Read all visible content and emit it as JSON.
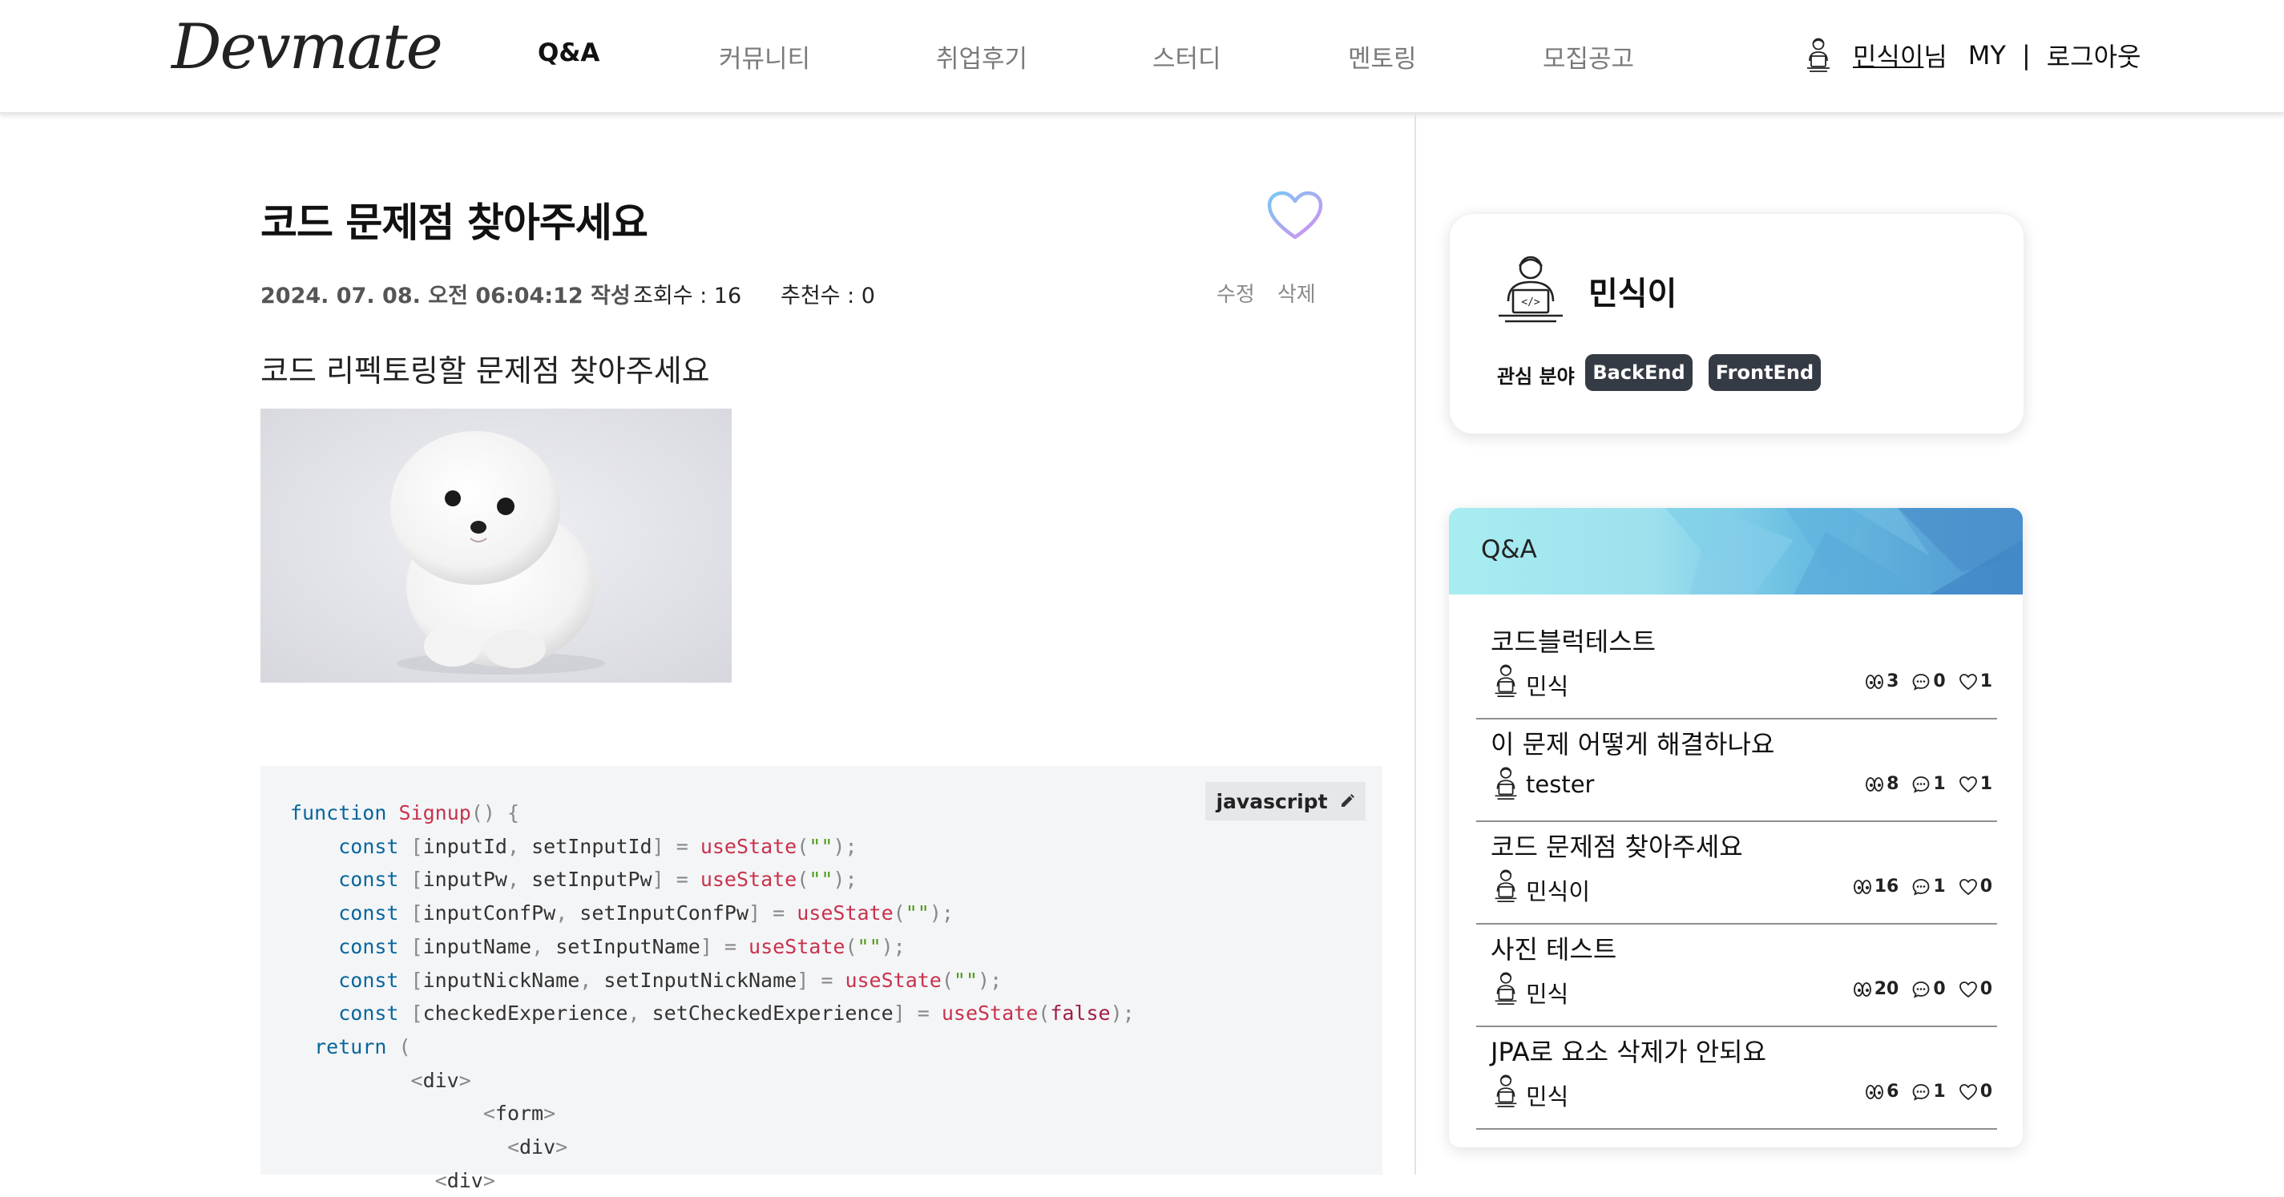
{
  "header": {
    "logo": "Devmate",
    "nav": [
      "Q&A",
      "커뮤니티",
      "취업후기",
      "스터디",
      "멘토링",
      "모집공고"
    ],
    "active_nav": "Q&A",
    "user": {
      "name": "민식이",
      "suffix": "님",
      "my": "MY",
      "separator": "|",
      "logout": "로그아웃"
    }
  },
  "post": {
    "title": "코드 문제점 찾아주세요",
    "date": "2024. 07. 08. 오전 06:04:12 작성",
    "views": "조회수 : 16",
    "recommends": "추천수 : 0",
    "edit_label": "수정",
    "delete_label": "삭제",
    "body": "코드 리펙토링할 문제점 찾아주세요",
    "image_icon": "white-pomeranian-puppy-photo",
    "code_language": "javascript",
    "code_lines": [
      "function Signup() {",
      "    const [inputId, setInputId] = useState(\"\");",
      "    const [inputPw, setInputPw] = useState(\"\");",
      "    const [inputConfPw, setInputConfPw] = useState(\"\");",
      "    const [inputName, setInputName] = useState(\"\");",
      "    const [inputNickName, setInputNickName] = useState(\"\");",
      "    const [checkedExperience, setCheckedExperience] = useState(false);",
      "  return (",
      "          <div>",
      "                <form>",
      "                  <div>",
      "            <div>"
    ]
  },
  "profile": {
    "name": "민식이",
    "interest_label": "관심 분야",
    "interests": [
      "BackEnd",
      "FrontEnd"
    ]
  },
  "qa_panel": {
    "title": "Q&A",
    "items": [
      {
        "title": "코드블럭테스트",
        "author": "민식",
        "views": "3",
        "comments": "0",
        "likes": "1"
      },
      {
        "title": "이 문제 어떻게 해결하나요",
        "author": "tester",
        "views": "8",
        "comments": "1",
        "likes": "1"
      },
      {
        "title": "코드 문제점 찾아주세요",
        "author": "민식이",
        "views": "16",
        "comments": "1",
        "likes": "0"
      },
      {
        "title": "사진 테스트",
        "author": "민식",
        "views": "20",
        "comments": "0",
        "likes": "0"
      },
      {
        "title": "JPA로 요소 삭제가 안되요",
        "author": "민식",
        "views": "6",
        "comments": "1",
        "likes": "0"
      }
    ]
  },
  "colors": {
    "chip_bg": "#353b45",
    "header_gradient_start": "#a6ecef",
    "header_gradient_end": "#4f97cf",
    "heart_gradient_start": "#78c8f5",
    "heart_gradient_end": "#d98cf0"
  }
}
